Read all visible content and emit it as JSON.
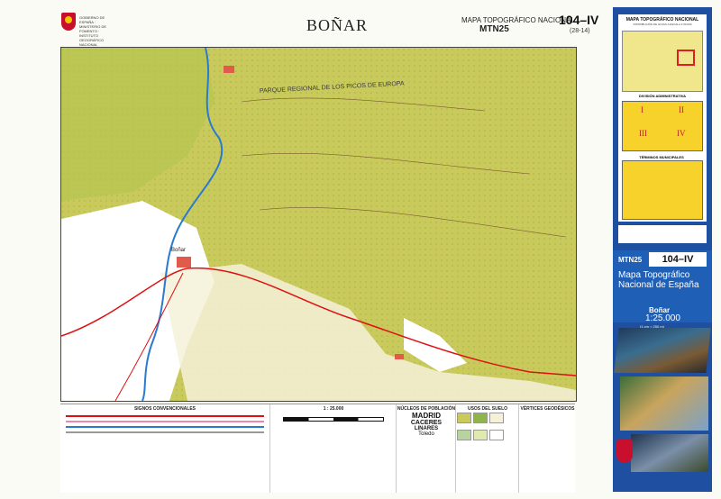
{
  "header": {
    "org": "GOBIERNO DE ESPAÑA · MINISTERIO DE FOMENTO · INSTITUTO GEOGRÁFICO NACIONAL",
    "title": "BOÑAR",
    "map_series": "MAPA TOPOGRÁFICO NACIONAL",
    "series_code": "MTN25",
    "sheet_number": "104–IV",
    "sheet_sub": "(28-14)"
  },
  "map": {
    "park_label": "PARQUE  REGIONAL  DE  LOS  PICOS  DE  EUROPA",
    "town_label": "Boñar",
    "colors": {
      "lowland": "#ffffff",
      "veg": "#c8c85a",
      "veg_dark": "#8fb44a",
      "road": "#d11",
      "water": "#2a7bd0"
    }
  },
  "legend": {
    "signs_title": "SIGNOS CONVENCIONALES",
    "scale_title": "1 : 25.000",
    "population_title": "NÚCLEOS DE POBLACIÓN",
    "population_examples": [
      "MADRID",
      "CACERES",
      "LINARES",
      "Toledo"
    ],
    "land_use_title": "USOS DEL SUELO",
    "vertices_title": "VÉRTICES GEODÉSICOS"
  },
  "sidebar": {
    "index_title": "MAPA TOPOGRÁFICO NACIONAL",
    "index_sub": "DISTRIBUCIÓN DE HOJAS A ESCALA 1:50.000",
    "division_title": "DIVISIÓN ADMINISTRATIVA",
    "quadrants": [
      "I",
      "II",
      "III",
      "IV"
    ],
    "terms_title": "TÉRMINOS MUNICIPALES",
    "series_code": "MTN25",
    "sheet_number": "104–IV",
    "series_name": "Mapa Topográfico Nacional de España",
    "place": "Boñar",
    "scale": "1:25.000",
    "scale_note": "(1 cm = 250 m)"
  }
}
